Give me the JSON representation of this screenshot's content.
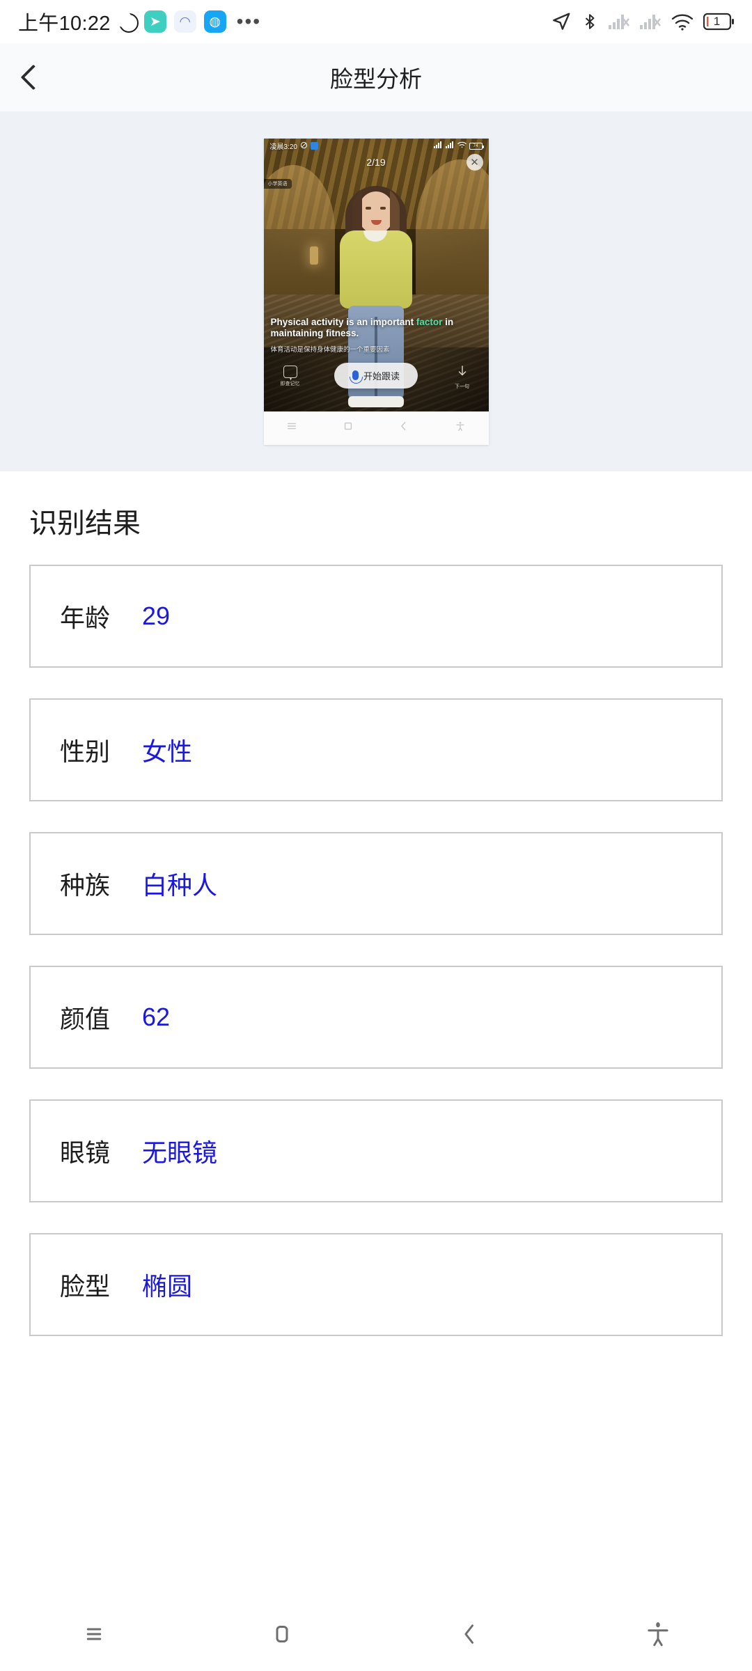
{
  "statusbar": {
    "time": "上午10:22",
    "moon_icon": "crescent-moon-icon",
    "app_icons": [
      {
        "name": "navigation-app-icon",
        "glyph": "➤"
      },
      {
        "name": "cloud-app-icon",
        "glyph": "◠"
      },
      {
        "name": "chat-app-icon",
        "glyph": "◍"
      }
    ],
    "overflow": "•••",
    "right_icons": [
      "location-arrow-icon",
      "bluetooth-icon",
      "signal-1-off-icon",
      "signal-2-off-icon",
      "wifi-icon",
      "battery-icon"
    ],
    "battery_level": "1"
  },
  "appbar": {
    "back_icon": "chevron-left-icon",
    "title": "脸型分析"
  },
  "preview": {
    "inner": {
      "status_time": "凌晨3:20",
      "status_mute_icon": "mute-icon",
      "status_badge_icon": "app-badge-icon",
      "battery_text": "74",
      "pager": "2/19",
      "close_icon": "close-icon",
      "corner_tag": "小学英语",
      "caption_en_before": "Physical activity is an important ",
      "caption_en_highlight": "factor",
      "caption_en_after": " in maintaining fitness.",
      "caption_zh": "体育活动是保持身体健康的一个重要因素",
      "left_tool_label": "即查记忆",
      "left_tool_icon": "note-icon",
      "right_tool_label": "下一句",
      "right_tool_icon": "download-arrow-icon",
      "cta_label": "开始跟读",
      "cta_icon": "microphone-icon",
      "nav_icons": [
        "menu-icon",
        "home-square-icon",
        "back-chevron-icon",
        "accessibility-icon"
      ]
    }
  },
  "results": {
    "title": "识别结果",
    "rows": [
      {
        "label": "年龄",
        "value": "29"
      },
      {
        "label": "性别",
        "value": "女性"
      },
      {
        "label": "种族",
        "value": "白种人"
      },
      {
        "label": "颜值",
        "value": "62"
      },
      {
        "label": "眼镜",
        "value": "无眼镜"
      },
      {
        "label": "脸型",
        "value": "椭圆"
      }
    ]
  },
  "sysnav": {
    "items": [
      {
        "name": "menu-icon",
        "label": "菜单"
      },
      {
        "name": "home-icon",
        "label": "主页"
      },
      {
        "name": "back-icon",
        "label": "返回"
      },
      {
        "name": "accessibility-icon",
        "label": "无障碍"
      }
    ]
  },
  "colors": {
    "value_blue": "#1a17e0",
    "preview_bg": "#eef2f6",
    "appbar_bg": "#f9fafb",
    "row_border": "#c9c9c9",
    "highlight_green": "#4fe0a5"
  }
}
